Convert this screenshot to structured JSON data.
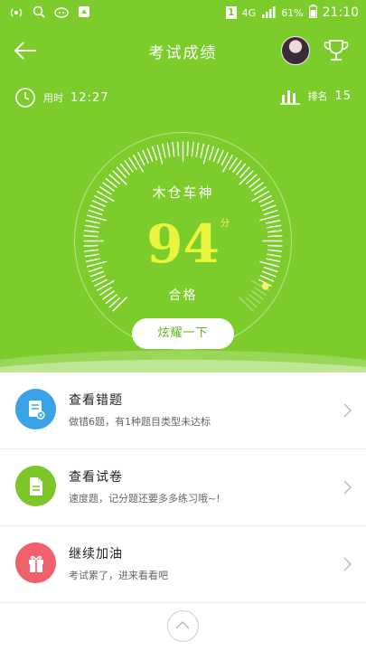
{
  "status_bar": {
    "sim_slot": "1",
    "network": "4G",
    "battery": "61%",
    "time": "21:10"
  },
  "header": {
    "title": "考试成绩"
  },
  "stats": {
    "time_label": "用时",
    "time_value": "12:27",
    "rank_label": "排名",
    "rank_value": "15"
  },
  "result": {
    "brand": "木仓车神",
    "score": "94",
    "score_unit": "分",
    "verdict": "合格",
    "gauge_fraction": 0.94
  },
  "share_button": {
    "label": "炫耀一下"
  },
  "list": [
    {
      "title": "查看错题",
      "subtitle": "做错6题，有1种题目类型未达标",
      "icon": "wrong-questions-icon",
      "color": "#3aa3e8"
    },
    {
      "title": "查看试卷",
      "subtitle": "速度题，记分题还要多多练习哦~!",
      "icon": "document-icon",
      "color": "#7cc62a"
    },
    {
      "title": "继续加油",
      "subtitle": "考试累了，进来看看吧",
      "icon": "gift-icon",
      "color": "#f0616b"
    }
  ],
  "colors": {
    "primary_green": "#7ccd2c",
    "score_yellow": "#e8f53c"
  }
}
